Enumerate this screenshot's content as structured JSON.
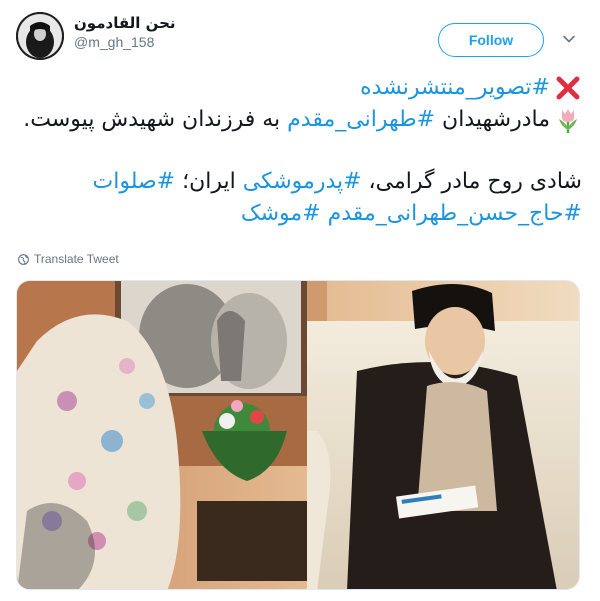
{
  "user": {
    "display_name": "نحن القادمون",
    "handle": "@m_gh_158"
  },
  "follow_label": "Follow",
  "tweet": {
    "line1": {
      "hashtag": "#تصویر_منتشرنشده"
    },
    "line2": {
      "pre": "مادرشهیدان ",
      "hashtag": "#طهرانی_مقدم",
      "post": " به فرزندان شهیدش پیوست."
    },
    "line3": {
      "pre": "شادی روح مادر گرامی، ",
      "hashtag1": "#پدرموشکی",
      "mid": " ایران؛ ",
      "hashtag2": "#صلوات"
    },
    "line4": {
      "hashtag1": "#حاج_حسن_طهرانی_مقدم",
      "space": " ",
      "hashtag2": "#موشک"
    }
  },
  "translate_label": "Translate Tweet",
  "icons": {
    "cross": "cross-mark-icon",
    "tulip": "tulip-icon",
    "globe": "globe-icon",
    "chevron": "chevron-down-icon"
  },
  "colors": {
    "accent": "#1da1f2",
    "hashtag": "#1b95e0",
    "muted": "#657786"
  }
}
